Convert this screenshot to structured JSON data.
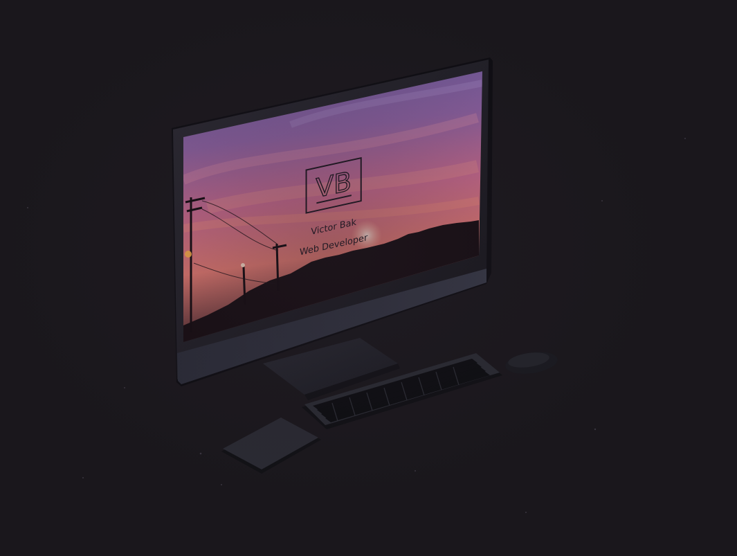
{
  "site": {
    "logo_text": "VB",
    "name": "Victor Bak",
    "role": "Web Developer"
  },
  "colors": {
    "background": "#1a171c",
    "sky_top": "#6b5a98",
    "sky_mid": "#c7688a",
    "sky_low": "#f07a5a",
    "text_on_screen": "#1e1620"
  }
}
